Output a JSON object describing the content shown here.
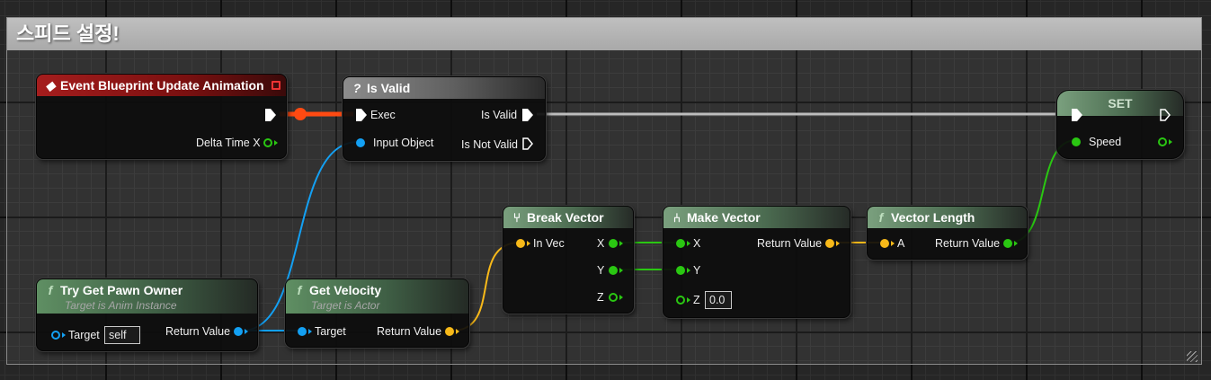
{
  "comment": {
    "title": "스피드 설정!"
  },
  "nodes": {
    "event": {
      "title": "Event Blueprint Update Animation",
      "pin_delta": "Delta Time X"
    },
    "isvalid": {
      "title": "Is Valid",
      "icon": "?",
      "pin_exec": "Exec",
      "pin_input": "Input Object",
      "pin_valid": "Is Valid",
      "pin_notvalid": "Is Not Valid"
    },
    "set": {
      "title": "SET",
      "pin_speed": "Speed"
    },
    "pawn": {
      "title": "Try Get Pawn Owner",
      "subtitle": "Target is Anim Instance",
      "pin_target": "Target",
      "target_value": "self",
      "pin_return": "Return Value"
    },
    "velocity": {
      "title": "Get Velocity",
      "subtitle": "Target is Actor",
      "pin_target": "Target",
      "pin_return": "Return Value"
    },
    "break": {
      "title": "Break Vector",
      "pin_in": "In Vec",
      "pin_x": "X",
      "pin_y": "Y",
      "pin_z": "Z"
    },
    "make": {
      "title": "Make Vector",
      "pin_x": "X",
      "pin_y": "Y",
      "pin_z": "Z",
      "z_value": "0.0",
      "pin_return": "Return Value"
    },
    "length": {
      "title": "Vector Length",
      "pin_a": "A",
      "pin_return": "Return Value"
    }
  },
  "icons": {
    "function": "f",
    "pure-cast": "function-icon",
    "event": "event-diamond-icon"
  },
  "colors": {
    "exec": "#ffffff",
    "object": "#13a0f3",
    "float": "#2ac712",
    "vector": "#f8b919",
    "exec_wire_active": "#ff4a12"
  }
}
